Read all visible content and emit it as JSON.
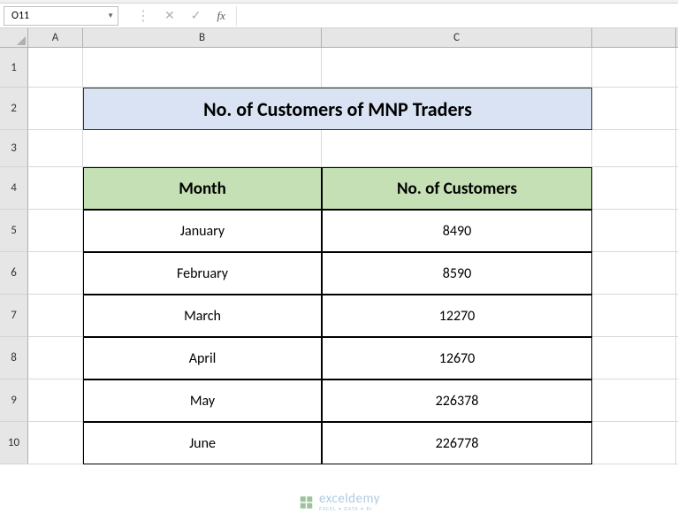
{
  "nameBox": {
    "value": "O11"
  },
  "formulaBar": {
    "fxLabel": "fx",
    "cancelIcon": "✕",
    "enterIcon": "✓"
  },
  "columns": {
    "A": "A",
    "B": "B",
    "C": "C",
    "D": ""
  },
  "rows": [
    "1",
    "2",
    "3",
    "4",
    "5",
    "6",
    "7",
    "8",
    "9",
    "10"
  ],
  "sheet": {
    "title": "No. of Customers of MNP Traders",
    "headers": {
      "month": "Month",
      "customers": "No. of Customers"
    },
    "data": [
      {
        "month": "January",
        "customers": "8490"
      },
      {
        "month": "February",
        "customers": "8590"
      },
      {
        "month": "March",
        "customers": "12270"
      },
      {
        "month": "April",
        "customers": "12670"
      },
      {
        "month": "May",
        "customers": "226378"
      },
      {
        "month": "June",
        "customers": "226778"
      }
    ]
  },
  "watermark": {
    "brand": "exceldemy",
    "tagline": "EXCEL • DATA • BI"
  }
}
